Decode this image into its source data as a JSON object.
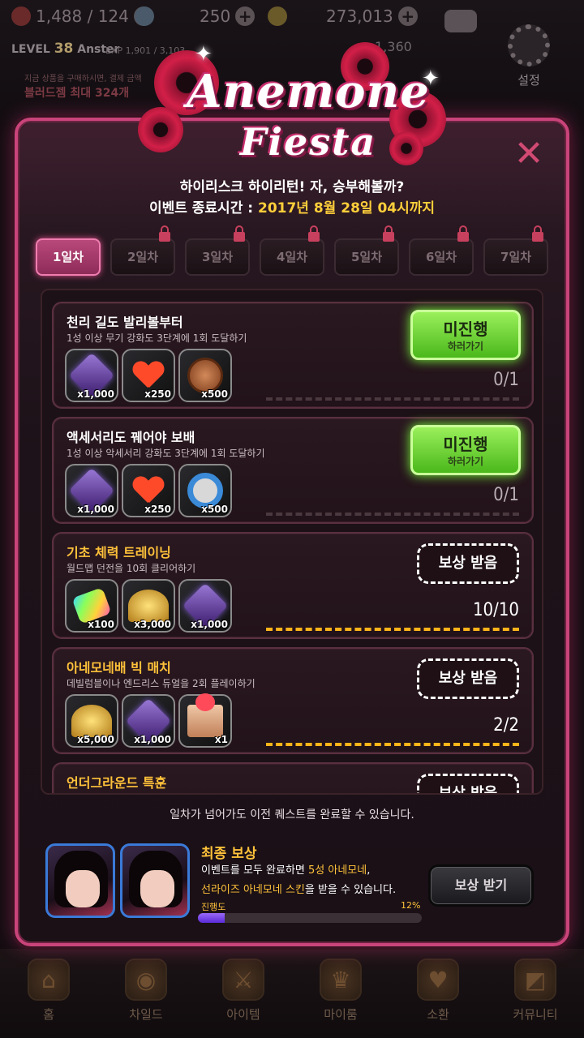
{
  "hud": {
    "hearts": "1,488 / 124",
    "gems": "250",
    "gold": "273,013",
    "level_prefix": "LEVEL",
    "level": "38",
    "player_name": "Anster",
    "exp": "EXP 1,901 / 3,103",
    "crystals": "1,360",
    "settings_label": "설정",
    "promo_line1": "지금 상품을 구매하시면, 결제 금액",
    "promo_line2": "블러드젬 최대 324개"
  },
  "event": {
    "title_line1": "Anemone",
    "title_line2": "Fiesta",
    "subtitle": "하이리스크 하이리턴! 자, 승부해볼까?",
    "end_time_label": "이벤트 종료시간 :",
    "end_time_value": "2017년 8월 28일 04시까지"
  },
  "tabs": [
    {
      "label": "1일차",
      "locked": false,
      "active": true
    },
    {
      "label": "2일차",
      "locked": true,
      "active": false
    },
    {
      "label": "3일차",
      "locked": true,
      "active": false
    },
    {
      "label": "4일차",
      "locked": true,
      "active": false
    },
    {
      "label": "5일차",
      "locked": true,
      "active": false
    },
    {
      "label": "6일차",
      "locked": true,
      "active": false
    },
    {
      "label": "7일차",
      "locked": true,
      "active": false
    }
  ],
  "quests": [
    {
      "title": "천리 길도 발리볼부터",
      "desc": "1성 이상 무기 강화도 3단계에 1회 도달하기",
      "rewards": [
        {
          "icon": "purple-gem-icon",
          "count": "x1,000"
        },
        {
          "icon": "heart-icon",
          "count": "x250"
        },
        {
          "icon": "copper-coin-icon",
          "count": "x500"
        }
      ],
      "status_main": "미진행",
      "status_sub": "하러가기",
      "progress": "0/1",
      "progress_fraction": 0
    },
    {
      "title": "액세서리도 꿰어야 보배",
      "desc": "1성 이상 악세서리 강화도 3단계에 1회 도달하기",
      "rewards": [
        {
          "icon": "purple-gem-icon",
          "count": "x1,000"
        },
        {
          "icon": "heart-icon",
          "count": "x250"
        },
        {
          "icon": "blue-ring-icon",
          "count": "x500"
        }
      ],
      "status_main": "미진행",
      "status_sub": "하러가기",
      "progress": "0/1",
      "progress_fraction": 0
    },
    {
      "title": "기초 체력 트레이닝",
      "desc": "월드맵 던전을 10회 클리어하기",
      "rewards": [
        {
          "icon": "rainbow-gem-icon",
          "count": "x100"
        },
        {
          "icon": "gold-pile-icon",
          "count": "x3,000"
        },
        {
          "icon": "purple-gem-icon",
          "count": "x1,000"
        }
      ],
      "claim_label": "보상 받음",
      "progress": "10/10",
      "progress_fraction": 1
    },
    {
      "title": "아네모네배 빅 매치",
      "desc": "데빌럼블이나 엔드리스 듀얼을 2회 플레이하기",
      "rewards": [
        {
          "icon": "gold-pile-icon",
          "count": "x5,000"
        },
        {
          "icon": "purple-gem-icon",
          "count": "x1,000"
        },
        {
          "icon": "gift-box-icon",
          "count": "x1"
        }
      ],
      "claim_label": "보상 받음",
      "progress": "2/2",
      "progress_fraction": 1
    },
    {
      "title": "언더그라운드 특훈",
      "claim_label": "보상 받음"
    }
  ],
  "carry_note": "일차가 넘어가도 이전 퀘스트를 완료할 수 있습니다.",
  "final_reward": {
    "title": "최종 보상",
    "line1_a": "이벤트를 모두 완료하면 ",
    "line1_b": "5성 아네모네",
    "line1_c": ",",
    "line2_a": "선라이즈 아네모네 스킨",
    "line2_b": "을 받을 수 있습니다.",
    "progress_label": "진행도",
    "progress_pct": "12%",
    "progress_fraction": 0.12,
    "claim_label": "보상 받기",
    "stars": "★★★★★"
  },
  "nav": [
    {
      "label": "홈",
      "icon": "home-icon"
    },
    {
      "label": "차일드",
      "icon": "child-icon"
    },
    {
      "label": "아이템",
      "icon": "item-icon"
    },
    {
      "label": "마이룸",
      "icon": "myroom-icon"
    },
    {
      "label": "소환",
      "icon": "summon-icon"
    },
    {
      "label": "커뮤니티",
      "icon": "community-icon"
    }
  ],
  "colors": {
    "accent_pink": "#c9447a",
    "gold_text": "#ffc23a",
    "green_button": "#4ab81a"
  }
}
